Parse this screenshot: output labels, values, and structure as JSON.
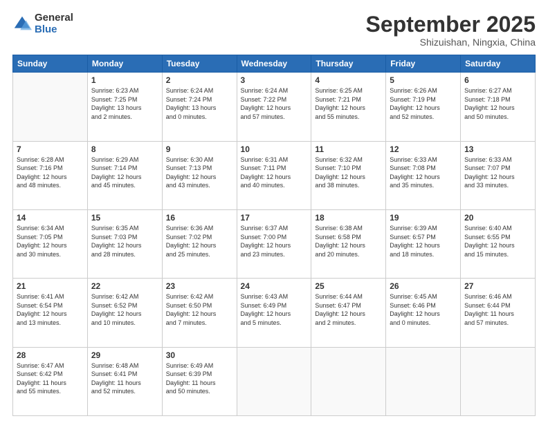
{
  "logo": {
    "general": "General",
    "blue": "Blue"
  },
  "header": {
    "month": "September 2025",
    "location": "Shizuishan, Ningxia, China"
  },
  "days_of_week": [
    "Sunday",
    "Monday",
    "Tuesday",
    "Wednesday",
    "Thursday",
    "Friday",
    "Saturday"
  ],
  "weeks": [
    [
      {
        "day": "",
        "info": ""
      },
      {
        "day": "1",
        "info": "Sunrise: 6:23 AM\nSunset: 7:25 PM\nDaylight: 13 hours\nand 2 minutes."
      },
      {
        "day": "2",
        "info": "Sunrise: 6:24 AM\nSunset: 7:24 PM\nDaylight: 13 hours\nand 0 minutes."
      },
      {
        "day": "3",
        "info": "Sunrise: 6:24 AM\nSunset: 7:22 PM\nDaylight: 12 hours\nand 57 minutes."
      },
      {
        "day": "4",
        "info": "Sunrise: 6:25 AM\nSunset: 7:21 PM\nDaylight: 12 hours\nand 55 minutes."
      },
      {
        "day": "5",
        "info": "Sunrise: 6:26 AM\nSunset: 7:19 PM\nDaylight: 12 hours\nand 52 minutes."
      },
      {
        "day": "6",
        "info": "Sunrise: 6:27 AM\nSunset: 7:18 PM\nDaylight: 12 hours\nand 50 minutes."
      }
    ],
    [
      {
        "day": "7",
        "info": "Sunrise: 6:28 AM\nSunset: 7:16 PM\nDaylight: 12 hours\nand 48 minutes."
      },
      {
        "day": "8",
        "info": "Sunrise: 6:29 AM\nSunset: 7:14 PM\nDaylight: 12 hours\nand 45 minutes."
      },
      {
        "day": "9",
        "info": "Sunrise: 6:30 AM\nSunset: 7:13 PM\nDaylight: 12 hours\nand 43 minutes."
      },
      {
        "day": "10",
        "info": "Sunrise: 6:31 AM\nSunset: 7:11 PM\nDaylight: 12 hours\nand 40 minutes."
      },
      {
        "day": "11",
        "info": "Sunrise: 6:32 AM\nSunset: 7:10 PM\nDaylight: 12 hours\nand 38 minutes."
      },
      {
        "day": "12",
        "info": "Sunrise: 6:33 AM\nSunset: 7:08 PM\nDaylight: 12 hours\nand 35 minutes."
      },
      {
        "day": "13",
        "info": "Sunrise: 6:33 AM\nSunset: 7:07 PM\nDaylight: 12 hours\nand 33 minutes."
      }
    ],
    [
      {
        "day": "14",
        "info": "Sunrise: 6:34 AM\nSunset: 7:05 PM\nDaylight: 12 hours\nand 30 minutes."
      },
      {
        "day": "15",
        "info": "Sunrise: 6:35 AM\nSunset: 7:03 PM\nDaylight: 12 hours\nand 28 minutes."
      },
      {
        "day": "16",
        "info": "Sunrise: 6:36 AM\nSunset: 7:02 PM\nDaylight: 12 hours\nand 25 minutes."
      },
      {
        "day": "17",
        "info": "Sunrise: 6:37 AM\nSunset: 7:00 PM\nDaylight: 12 hours\nand 23 minutes."
      },
      {
        "day": "18",
        "info": "Sunrise: 6:38 AM\nSunset: 6:58 PM\nDaylight: 12 hours\nand 20 minutes."
      },
      {
        "day": "19",
        "info": "Sunrise: 6:39 AM\nSunset: 6:57 PM\nDaylight: 12 hours\nand 18 minutes."
      },
      {
        "day": "20",
        "info": "Sunrise: 6:40 AM\nSunset: 6:55 PM\nDaylight: 12 hours\nand 15 minutes."
      }
    ],
    [
      {
        "day": "21",
        "info": "Sunrise: 6:41 AM\nSunset: 6:54 PM\nDaylight: 12 hours\nand 13 minutes."
      },
      {
        "day": "22",
        "info": "Sunrise: 6:42 AM\nSunset: 6:52 PM\nDaylight: 12 hours\nand 10 minutes."
      },
      {
        "day": "23",
        "info": "Sunrise: 6:42 AM\nSunset: 6:50 PM\nDaylight: 12 hours\nand 7 minutes."
      },
      {
        "day": "24",
        "info": "Sunrise: 6:43 AM\nSunset: 6:49 PM\nDaylight: 12 hours\nand 5 minutes."
      },
      {
        "day": "25",
        "info": "Sunrise: 6:44 AM\nSunset: 6:47 PM\nDaylight: 12 hours\nand 2 minutes."
      },
      {
        "day": "26",
        "info": "Sunrise: 6:45 AM\nSunset: 6:46 PM\nDaylight: 12 hours\nand 0 minutes."
      },
      {
        "day": "27",
        "info": "Sunrise: 6:46 AM\nSunset: 6:44 PM\nDaylight: 11 hours\nand 57 minutes."
      }
    ],
    [
      {
        "day": "28",
        "info": "Sunrise: 6:47 AM\nSunset: 6:42 PM\nDaylight: 11 hours\nand 55 minutes."
      },
      {
        "day": "29",
        "info": "Sunrise: 6:48 AM\nSunset: 6:41 PM\nDaylight: 11 hours\nand 52 minutes."
      },
      {
        "day": "30",
        "info": "Sunrise: 6:49 AM\nSunset: 6:39 PM\nDaylight: 11 hours\nand 50 minutes."
      },
      {
        "day": "",
        "info": ""
      },
      {
        "day": "",
        "info": ""
      },
      {
        "day": "",
        "info": ""
      },
      {
        "day": "",
        "info": ""
      }
    ]
  ]
}
